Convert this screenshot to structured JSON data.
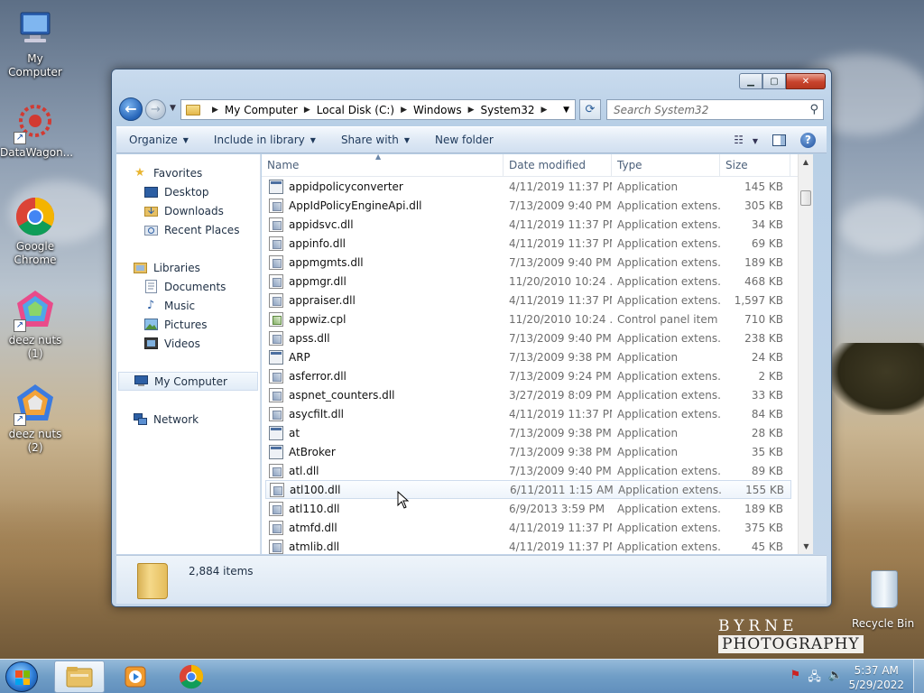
{
  "desktop": {
    "icons": [
      {
        "label": "My Computer",
        "icon": "computer-icon"
      },
      {
        "label": "DataWagon...",
        "icon": "datawagon-icon"
      },
      {
        "label": "Google Chrome",
        "icon": "chrome-icon"
      },
      {
        "label": "deez nuts (1)",
        "icon": "app-icon"
      },
      {
        "label": "deez nuts (2)",
        "icon": "app-icon"
      }
    ],
    "recycle_bin": "Recycle Bin",
    "watermark_left": "BYRNE",
    "watermark_right": "PHOTOGRAPHY"
  },
  "window": {
    "breadcrumbs": [
      "My Computer",
      "Local Disk (C:)",
      "Windows",
      "System32"
    ],
    "search_placeholder": "Search System32",
    "toolbar": {
      "organize": "Organize",
      "include": "Include in library",
      "share": "Share with",
      "new_folder": "New folder"
    },
    "nav": {
      "favorites": "Favorites",
      "favorites_items": [
        "Desktop",
        "Downloads",
        "Recent Places"
      ],
      "libraries": "Libraries",
      "libraries_items": [
        "Documents",
        "Music",
        "Pictures",
        "Videos"
      ],
      "computer": "My Computer",
      "network": "Network"
    },
    "columns": {
      "name": "Name",
      "date": "Date modified",
      "type": "Type",
      "size": "Size"
    },
    "files": [
      {
        "name": "appidpolicyconverter",
        "date": "4/11/2019 11:37 PM",
        "type": "Application",
        "size": "145 KB",
        "kind": "exe"
      },
      {
        "name": "AppIdPolicyEngineApi.dll",
        "date": "7/13/2009 9:40 PM",
        "type": "Application extens...",
        "size": "305 KB",
        "kind": "dll"
      },
      {
        "name": "appidsvc.dll",
        "date": "4/11/2019 11:37 PM",
        "type": "Application extens...",
        "size": "34 KB",
        "kind": "dll"
      },
      {
        "name": "appinfo.dll",
        "date": "4/11/2019 11:37 PM",
        "type": "Application extens...",
        "size": "69 KB",
        "kind": "dll"
      },
      {
        "name": "appmgmts.dll",
        "date": "7/13/2009 9:40 PM",
        "type": "Application extens...",
        "size": "189 KB",
        "kind": "dll"
      },
      {
        "name": "appmgr.dll",
        "date": "11/20/2010 10:24 ...",
        "type": "Application extens...",
        "size": "468 KB",
        "kind": "dll"
      },
      {
        "name": "appraiser.dll",
        "date": "4/11/2019 11:37 PM",
        "type": "Application extens...",
        "size": "1,597 KB",
        "kind": "dll"
      },
      {
        "name": "appwiz.cpl",
        "date": "11/20/2010 10:24 ...",
        "type": "Control panel item",
        "size": "710 KB",
        "kind": "cpl"
      },
      {
        "name": "apss.dll",
        "date": "7/13/2009 9:40 PM",
        "type": "Application extens...",
        "size": "238 KB",
        "kind": "dll"
      },
      {
        "name": "ARP",
        "date": "7/13/2009 9:38 PM",
        "type": "Application",
        "size": "24 KB",
        "kind": "exe"
      },
      {
        "name": "asferror.dll",
        "date": "7/13/2009 9:24 PM",
        "type": "Application extens...",
        "size": "2 KB",
        "kind": "dll"
      },
      {
        "name": "aspnet_counters.dll",
        "date": "3/27/2019 8:09 PM",
        "type": "Application extens...",
        "size": "33 KB",
        "kind": "dll"
      },
      {
        "name": "asycfilt.dll",
        "date": "4/11/2019 11:37 PM",
        "type": "Application extens...",
        "size": "84 KB",
        "kind": "dll"
      },
      {
        "name": "at",
        "date": "7/13/2009 9:38 PM",
        "type": "Application",
        "size": "28 KB",
        "kind": "exe"
      },
      {
        "name": "AtBroker",
        "date": "7/13/2009 9:38 PM",
        "type": "Application",
        "size": "35 KB",
        "kind": "exe"
      },
      {
        "name": "atl.dll",
        "date": "7/13/2009 9:40 PM",
        "type": "Application extens...",
        "size": "89 KB",
        "kind": "dll"
      },
      {
        "name": "atl100.dll",
        "date": "6/11/2011 1:15 AM",
        "type": "Application extens...",
        "size": "155 KB",
        "kind": "dll",
        "hover": true
      },
      {
        "name": "atl110.dll",
        "date": "6/9/2013 3:59 PM",
        "type": "Application extens...",
        "size": "189 KB",
        "kind": "dll"
      },
      {
        "name": "atmfd.dll",
        "date": "4/11/2019 11:37 PM",
        "type": "Application extens...",
        "size": "375 KB",
        "kind": "dll"
      },
      {
        "name": "atmlib.dll",
        "date": "4/11/2019 11:37 PM",
        "type": "Application extens...",
        "size": "45 KB",
        "kind": "dll"
      }
    ],
    "item_count": "2,884 items"
  },
  "taskbar": {
    "time": "5:37 AM",
    "date": "5/29/2022"
  }
}
